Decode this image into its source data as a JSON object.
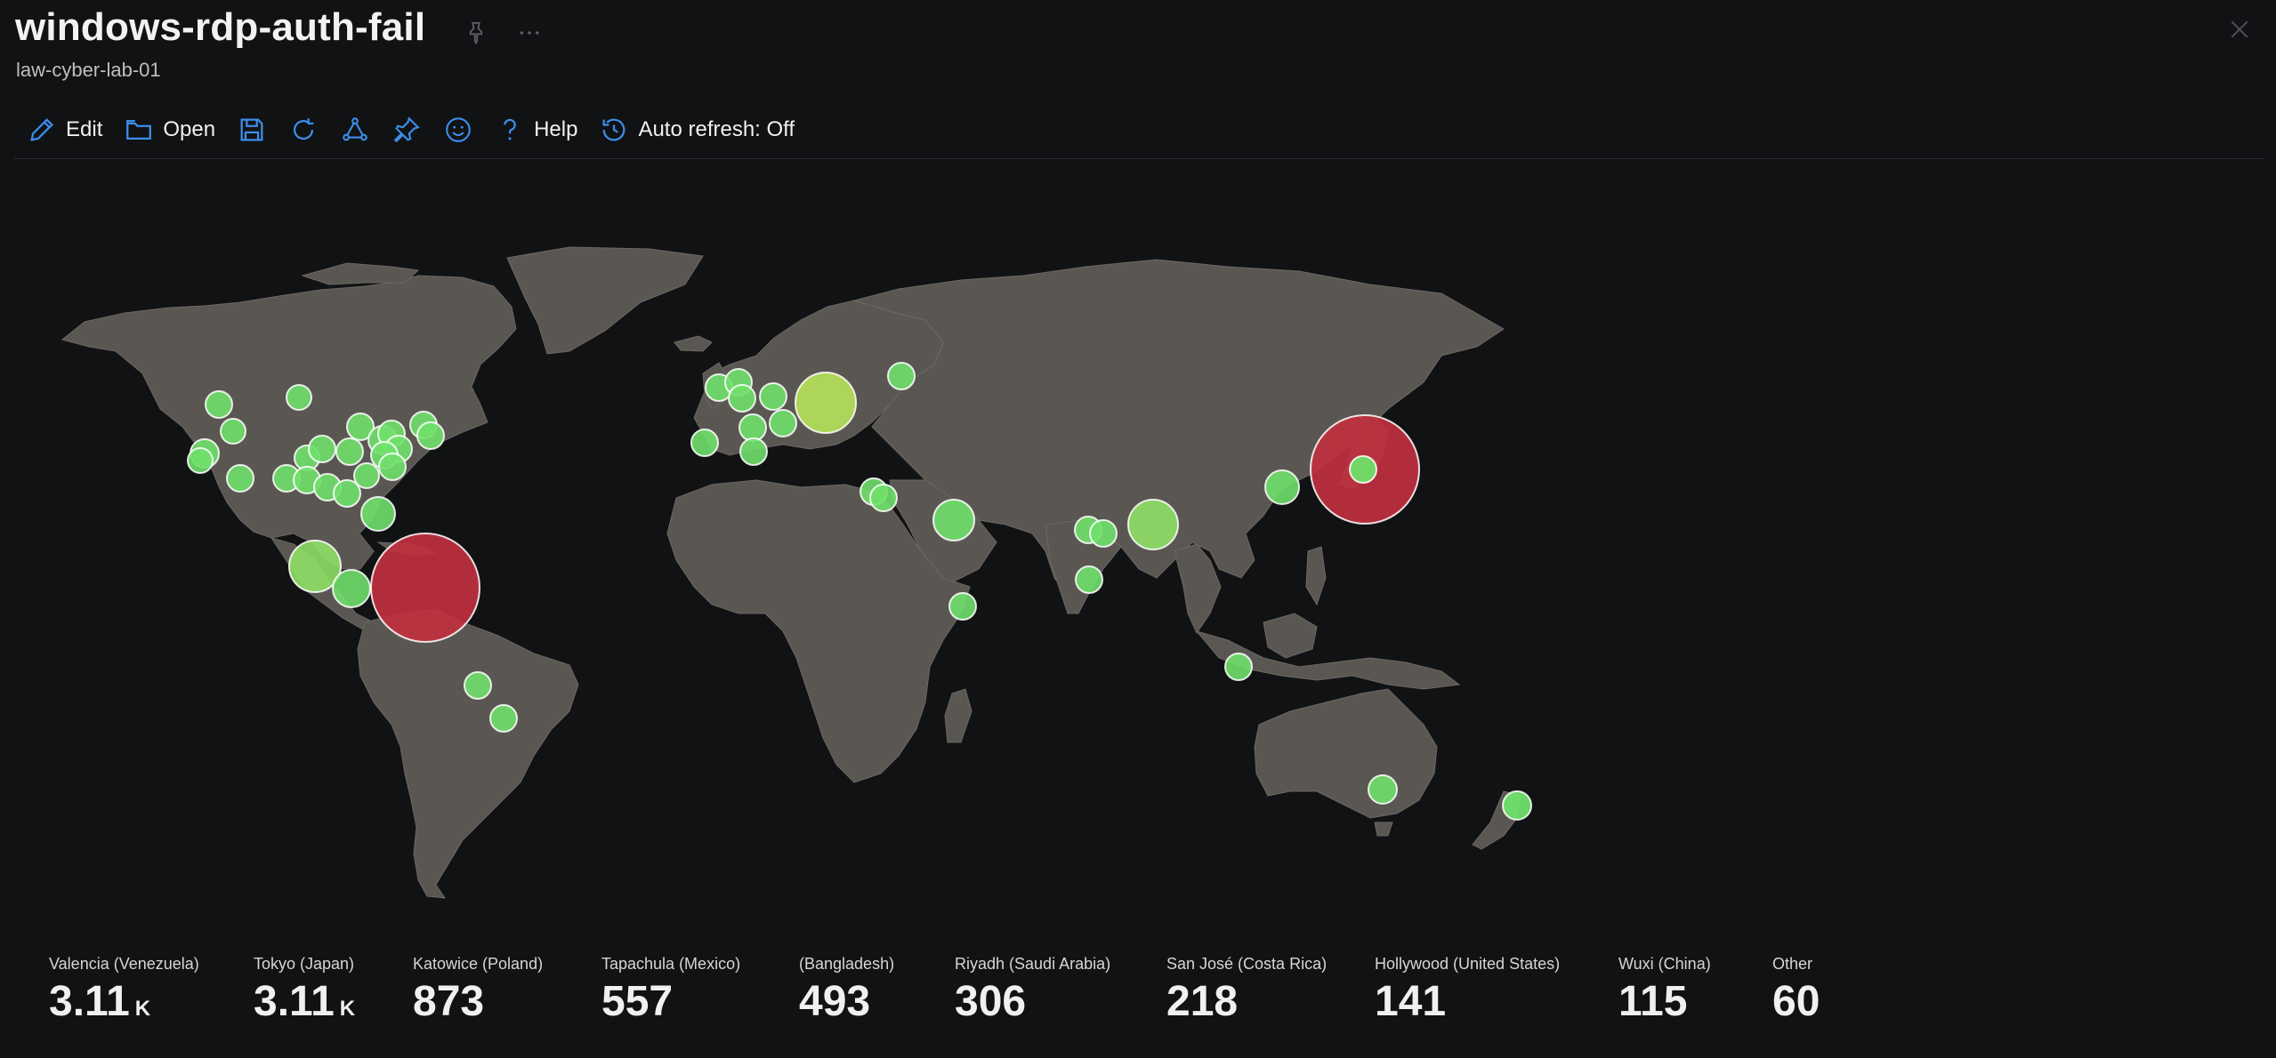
{
  "header": {
    "title": "windows-rdp-auth-fail",
    "subtitle": "law-cyber-lab-01"
  },
  "toolbar": {
    "edit_label": "Edit",
    "open_label": "Open",
    "help_label": "Help",
    "auto_refresh_label": "Auto refresh: Off"
  },
  "colors": {
    "accent": "#3b8eea",
    "land": "#5a5753",
    "bubble_low": "#6fe06a",
    "bubble_mid": "#b6e35a",
    "bubble_high": "#c0303f"
  },
  "legend": [
    {
      "label": "Valencia (Venezuela)",
      "value": "3.11",
      "unit": "K"
    },
    {
      "label": "Tokyo (Japan)",
      "value": "3.11",
      "unit": "K"
    },
    {
      "label": "Katowice (Poland)",
      "value": "873",
      "unit": ""
    },
    {
      "label": "Tapachula (Mexico)",
      "value": "557",
      "unit": ""
    },
    {
      "label": "(Bangladesh)",
      "value": "493",
      "unit": ""
    },
    {
      "label": "Riyadh (Saudi Arabia)",
      "value": "306",
      "unit": ""
    },
    {
      "label": "San José (Costa Rica)",
      "value": "218",
      "unit": ""
    },
    {
      "label": "Hollywood (United States)",
      "value": "141",
      "unit": ""
    },
    {
      "label": "Wuxi (China)",
      "value": "115",
      "unit": ""
    },
    {
      "label": "Other",
      "value": "60",
      "unit": ""
    }
  ]
}
